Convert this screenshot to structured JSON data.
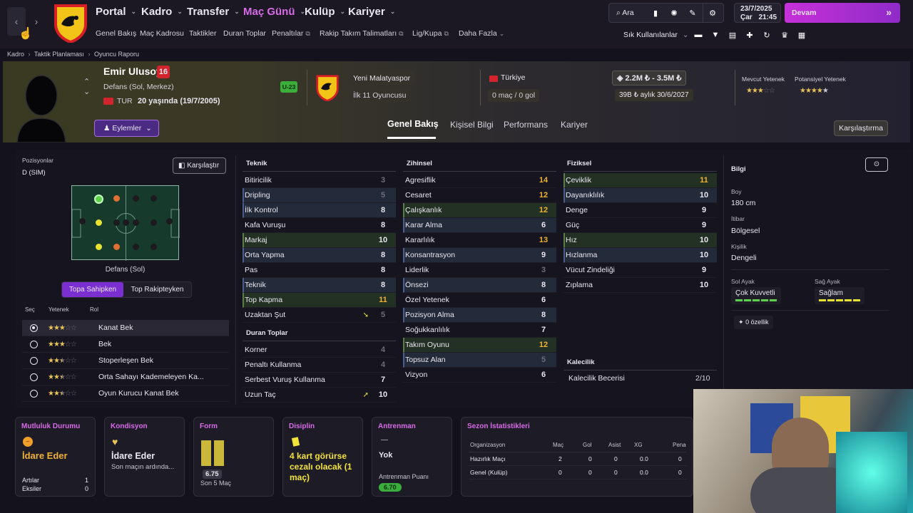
{
  "topbar": {
    "menu": [
      "Portal",
      "Kadro",
      "Transfer",
      "Maç Günü",
      "Kulüp",
      "Kariyer"
    ],
    "submenu": [
      "Genel Bakış",
      "Maç Kadrosu",
      "Taktikler",
      "Duran Toplar",
      "Penaltılar",
      "Rakip Takım Talimatları",
      "Lig/Kupa",
      "Daha Fazla"
    ],
    "search_label": "Ara",
    "shortcuts_label": "Sık Kullanılanlar",
    "date": "23/7/2025",
    "day": "Çar",
    "time": "21:45",
    "continue_label": "Devam"
  },
  "breadcrumb": [
    "Kadro",
    "Taktik Planlaması",
    "Oyuncu Raporu"
  ],
  "player": {
    "name": "Emir Ulusoy",
    "number": "16",
    "position": "Defans (Sol, Merkez)",
    "nation_code": "TUR",
    "age_text": "20 yaşında (19/7/2005)",
    "u23_badge": "U-23",
    "club": "Yeni Malatyaspor",
    "squad_status": "İlk 11 Oyuncusu",
    "country": "Türkiye",
    "caps": "0 maç / 0 gol",
    "value": "2.2M ₺ - 3.5M ₺",
    "wage": "39B ₺ aylık",
    "contract": "30/6/2027",
    "current_ability_label": "Mevcut Yetenek",
    "potential_ability_label": "Potansiyel Yetenek",
    "current_stars": 3,
    "potential_stars": 4.5,
    "actions_label": "Eylemler"
  },
  "tabs": [
    "Genel Bakış",
    "Kişisel Bilgi",
    "Performans",
    "Kariyer"
  ],
  "compare_label": "Karşılaştırma",
  "positions": {
    "title": "Pozisyonlar",
    "value": "D (SIM)",
    "compare_button": "Karşılaştır",
    "pitch_caption": "Defans (Sol)",
    "toggle": [
      "Topa Sahipken",
      "Top Rakipteyken"
    ],
    "role_headers": [
      "Seç",
      "Yetenek",
      "Rol"
    ],
    "roles": [
      {
        "name": "Kanat Bek",
        "stars": 3,
        "selected": true
      },
      {
        "name": "Bek",
        "stars": 3,
        "selected": false
      },
      {
        "name": "Stoperleşen Bek",
        "stars": 2.5,
        "selected": false
      },
      {
        "name": "Orta Sahayı Kademeleyen Ka...",
        "stars": 2.5,
        "selected": false
      },
      {
        "name": "Oyun Kurucu Kanat Bek",
        "stars": 2.5,
        "selected": false
      }
    ]
  },
  "attributes": {
    "teknik_title": "Teknik",
    "teknik": [
      {
        "name": "Bitiricilik",
        "value": "3",
        "style": "gray"
      },
      {
        "name": "Dripling",
        "value": "5",
        "style": "gray",
        "hl": "b"
      },
      {
        "name": "İlk Kontrol",
        "value": "8",
        "hl": "b"
      },
      {
        "name": "Kafa Vuruşu",
        "value": "8"
      },
      {
        "name": "Markaj",
        "value": "10",
        "hl": "g"
      },
      {
        "name": "Orta Yapma",
        "value": "8",
        "hl": "b"
      },
      {
        "name": "Pas",
        "value": "8"
      },
      {
        "name": "Teknik",
        "value": "8",
        "hl": "b"
      },
      {
        "name": "Top Kapma",
        "value": "11",
        "style": "orange",
        "hl": "g"
      },
      {
        "name": "Uzaktan Şut",
        "value": "5",
        "style": "gray",
        "arrow": "down"
      }
    ],
    "duran_title": "Duran Toplar",
    "duran": [
      {
        "name": "Korner",
        "value": "4",
        "style": "gray"
      },
      {
        "name": "Penaltı Kullanma",
        "value": "4",
        "style": "gray"
      },
      {
        "name": "Serbest Vuruş Kullanma",
        "value": "7"
      },
      {
        "name": "Uzun Taç",
        "value": "10",
        "arrow": "up"
      }
    ],
    "zihinsel_title": "Zihinsel",
    "zihinsel": [
      {
        "name": "Agresiflik",
        "value": "14",
        "style": "orange"
      },
      {
        "name": "Cesaret",
        "value": "12",
        "style": "orange"
      },
      {
        "name": "Çalışkanlık",
        "value": "12",
        "style": "orange",
        "hl": "g"
      },
      {
        "name": "Karar Alma",
        "value": "6",
        "hl": "b"
      },
      {
        "name": "Kararlılık",
        "value": "13",
        "style": "orange"
      },
      {
        "name": "Konsantrasyon",
        "value": "9",
        "hl": "b"
      },
      {
        "name": "Liderlik",
        "value": "3",
        "style": "gray"
      },
      {
        "name": "Önsezi",
        "value": "8",
        "hl": "b"
      },
      {
        "name": "Özel Yetenek",
        "value": "6"
      },
      {
        "name": "Pozisyon Alma",
        "value": "8",
        "hl": "b"
      },
      {
        "name": "Soğukkanlılık",
        "value": "7"
      },
      {
        "name": "Takım Oyunu",
        "value": "12",
        "style": "orange",
        "hl": "g"
      },
      {
        "name": "Topsuz Alan",
        "value": "5",
        "style": "gray",
        "hl": "b"
      },
      {
        "name": "Vizyon",
        "value": "6"
      }
    ],
    "fiziksel_title": "Fiziksel",
    "fiziksel": [
      {
        "name": "Çeviklik",
        "value": "11",
        "style": "orange",
        "hl": "g"
      },
      {
        "name": "Dayanıklılık",
        "value": "10",
        "hl": "b"
      },
      {
        "name": "Denge",
        "value": "9"
      },
      {
        "name": "Güç",
        "value": "9"
      },
      {
        "name": "Hız",
        "value": "10",
        "hl": "g"
      },
      {
        "name": "Hızlanma",
        "value": "10",
        "hl": "b"
      },
      {
        "name": "Vücut Zindeliği",
        "value": "9"
      },
      {
        "name": "Zıplama",
        "value": "10"
      }
    ],
    "kaleci_title": "Kalecilik",
    "kaleci_label": "Kalecilik Becerisi",
    "kaleci_value": "2/10"
  },
  "info": {
    "title": "Bilgi",
    "height_label": "Boy",
    "height": "180 cm",
    "rep_label": "İtibar",
    "rep": "Bölgesel",
    "pers_label": "Kişilik",
    "pers": "Dengeli",
    "left_foot_label": "Sol Ayak",
    "left_foot": "Çok Kuvvetli",
    "right_foot_label": "Sağ Ayak",
    "right_foot": "Sağlam",
    "traits": "0 özellik"
  },
  "bottom": {
    "happiness": {
      "title": "Mutluluk Durumu",
      "value": "İdare Eder",
      "plus_label": "Artılar",
      "plus": "1",
      "minus_label": "Eksiler",
      "minus": "0"
    },
    "condition": {
      "title": "Kondisyon",
      "value": "İdare Eder",
      "sub": "Son maçın ardında..."
    },
    "form": {
      "title": "Form",
      "rating": "6.75",
      "sub": "Son 5 Maç"
    },
    "discipline": {
      "title": "Disiplin",
      "value": "4 kart görürse cezalı olacak (1 maç)"
    },
    "training": {
      "title": "Antrenman",
      "dash": "—",
      "value": "Yok",
      "points_label": "Antrenman Puanı",
      "points": "6.70"
    },
    "season": {
      "title": "Sezon İstatistikleri",
      "headers": [
        "Organizasyon",
        "Maç",
        "Gol",
        "Asist",
        "XG",
        "Pena"
      ],
      "rows": [
        [
          "Hazırlık Maçı",
          "2",
          "0",
          "0",
          "0.0",
          "0"
        ],
        [
          "Genel (Kulüp)",
          "0",
          "0",
          "0",
          "0.0",
          "0"
        ]
      ]
    }
  },
  "colors": {
    "accent": "#d86be8",
    "orange": "#f0b232",
    "green": "#5cd14a",
    "yellow": "#f2e23a"
  }
}
